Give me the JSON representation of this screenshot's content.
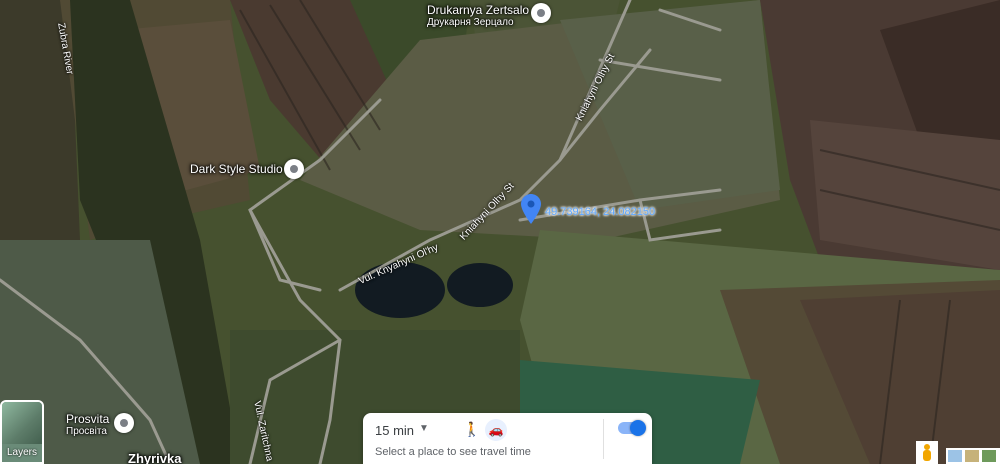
{
  "map": {
    "type": "satellite",
    "places": [
      {
        "name": "Drukarnya Zertsalo",
        "native": "Друкарня Зерцало"
      },
      {
        "name": "Dark Style Studio"
      },
      {
        "name": "Prosvita",
        "native": "Просвіта"
      }
    ],
    "localities": [
      "Zhyrivka"
    ],
    "rivers": [
      "Zubra River"
    ],
    "streets": {
      "knyahyni_olhy_north": "Kniahyni Olhy St",
      "knyahyni_olhy_mid": "Kniahyni Olhy St",
      "vul_knyahyni": "Vul. Knyahyni Ol'hy",
      "zaritchna": "Vul. Zaritchna"
    },
    "dropped_pin": {
      "coordinates": "49.739164, 24.082150"
    }
  },
  "controls": {
    "layers_label": "Layers"
  },
  "travel_time": {
    "duration": "15 min",
    "hint": "Select a place to see travel time"
  },
  "colors": {
    "pin": "#4285f4",
    "coord_text": "#5fa8ff",
    "toggle": "#1a73e8"
  }
}
